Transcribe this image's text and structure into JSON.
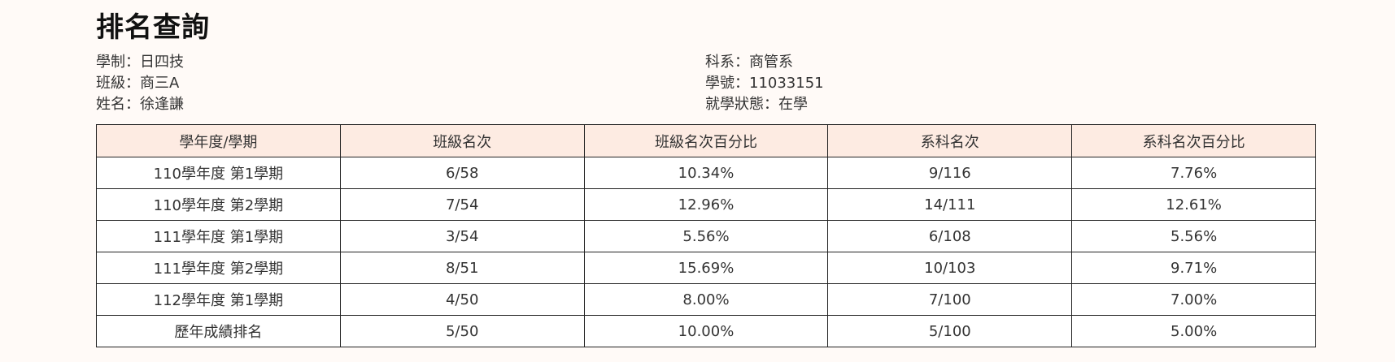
{
  "page_title": "排名查詢",
  "student_info": {
    "system": "學制：日四技",
    "class": "班級：商三A",
    "name": "姓名：徐逢謙",
    "department": "科系：商管系",
    "student_id": "學號：11033151",
    "status": "就學狀態：在學"
  },
  "ranking_table": {
    "headers": [
      "學年度/學期",
      "班級名次",
      "班級名次百分比",
      "系科名次",
      "系科名次百分比"
    ],
    "rows": [
      [
        "110學年度 第1學期",
        "6/58",
        "10.34%",
        "9/116",
        "7.76%"
      ],
      [
        "110學年度 第2學期",
        "7/54",
        "12.96%",
        "14/111",
        "12.61%"
      ],
      [
        "111學年度 第1學期",
        "3/54",
        "5.56%",
        "6/108",
        "5.56%"
      ],
      [
        "111學年度 第2學期",
        "8/51",
        "15.69%",
        "10/103",
        "9.71%"
      ],
      [
        "112學年度 第1學期",
        "4/50",
        "8.00%",
        "7/100",
        "7.00%"
      ],
      [
        "歷年成績排名",
        "5/50",
        "10.00%",
        "5/100",
        "5.00%"
      ]
    ]
  },
  "colors": {
    "background": "#fffaf7",
    "header_background": "#fdebe2",
    "border": "#222222"
  }
}
